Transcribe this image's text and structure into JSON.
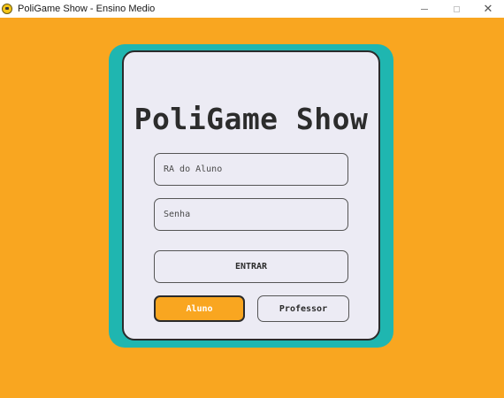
{
  "window": {
    "title": "PoliGame Show - Ensino Medio",
    "controls": {
      "minimize": "minimize",
      "maximize": "maximize",
      "close": "✕"
    }
  },
  "login": {
    "title": "PoliGame Show",
    "ra_placeholder": "RA do Aluno",
    "ra_value": "",
    "password_placeholder": "Senha",
    "password_value": "",
    "enter_label": "ENTRAR",
    "role_student_label": "Aluno",
    "role_teacher_label": "Professor"
  },
  "colors": {
    "background": "#f9a620",
    "frame": "#1fb6b0",
    "card": "#ecebf4",
    "selected_role": "#f9a620"
  },
  "state": {
    "selected_role": "Aluno"
  }
}
